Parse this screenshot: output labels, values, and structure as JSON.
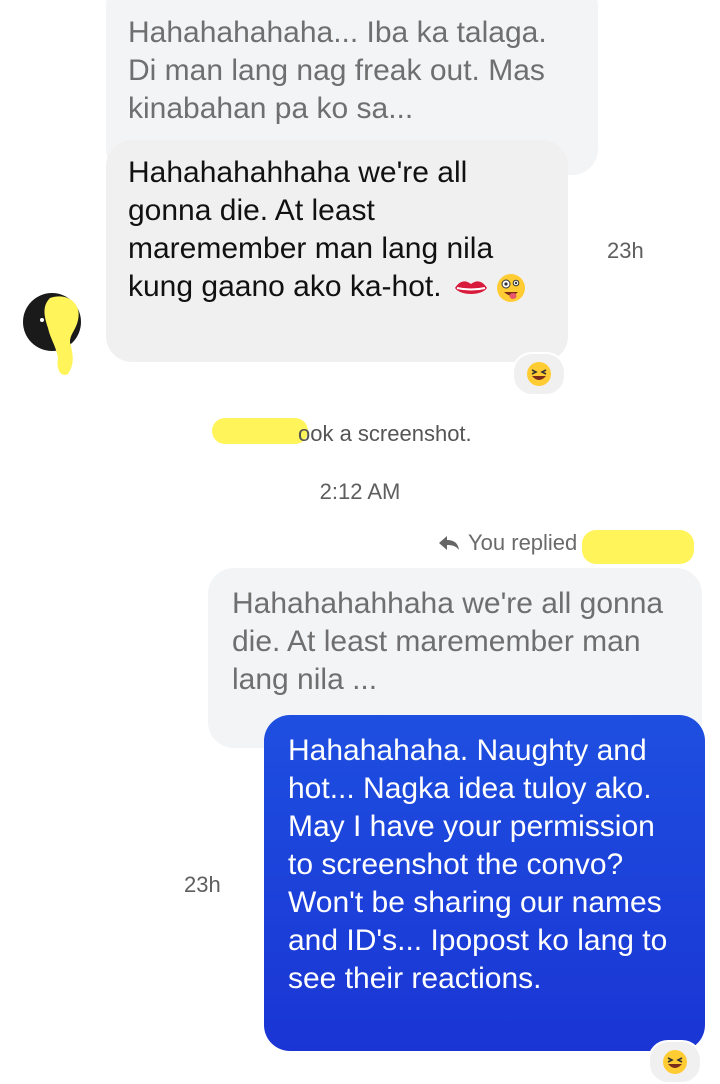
{
  "messages": {
    "top_quote": {
      "text": "Hahahahahaha... Iba ka talaga. Di man lang nag freak out. Mas kinabahan pa ko sa..."
    },
    "received": {
      "text": "Hahahahahhaha we're all gonna die. At least maremember man lang nila kung gaano ako ka-hot.",
      "time": "23h",
      "reaction": "laughing-face"
    },
    "system": {
      "text": "took a screenshot.",
      "visible_text": "ook a screenshot."
    },
    "timestamp": "2:12 AM",
    "reply_header": "You replied",
    "reply_quote": {
      "text": "Hahahahahhaha we're all gonna die. At least maremember man lang nila ..."
    },
    "sent": {
      "text": "Hahahahaha. Naughty and hot... Nagka idea tuloy ako. May I have your permission to screenshot the convo? Won't be sharing our names and ID's... Ipopost ko lang to see their reactions.",
      "time": "23h",
      "reaction": "laughing-face"
    }
  },
  "colors": {
    "sent_bubble": "#1a35d4",
    "received_bubble": "#f0f0f0",
    "redaction": "#fff45a"
  }
}
